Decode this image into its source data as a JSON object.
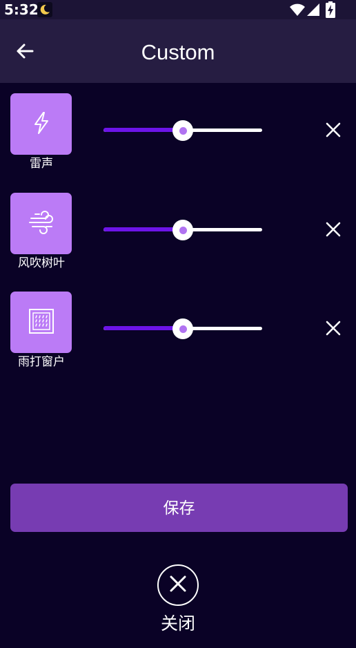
{
  "status_bar": {
    "time": "5:32",
    "icons": [
      "moon-icon",
      "wifi-icon",
      "signal-icon",
      "battery-charging-icon"
    ]
  },
  "app_bar": {
    "title": "Custom",
    "back_icon": "arrow-left-icon"
  },
  "sounds": [
    {
      "label": "雷声",
      "icon": "lightning-icon",
      "volume": 0.5
    },
    {
      "label": "风吹树叶",
      "icon": "wind-icon",
      "volume": 0.5
    },
    {
      "label": "雨打窗户",
      "icon": "rain-window-icon",
      "volume": 0.5
    }
  ],
  "actions": {
    "save_label": "保存",
    "close_label": "关闭",
    "close_icon": "close-icon"
  },
  "colors": {
    "background": "#0a0226",
    "app_bar": "#261d42",
    "status_bar": "#1c1436",
    "tile": "#bb7bf6",
    "slider_fill": "#6d14e8",
    "thumb_dot": "#b173f1",
    "save_button": "#773cb2"
  }
}
